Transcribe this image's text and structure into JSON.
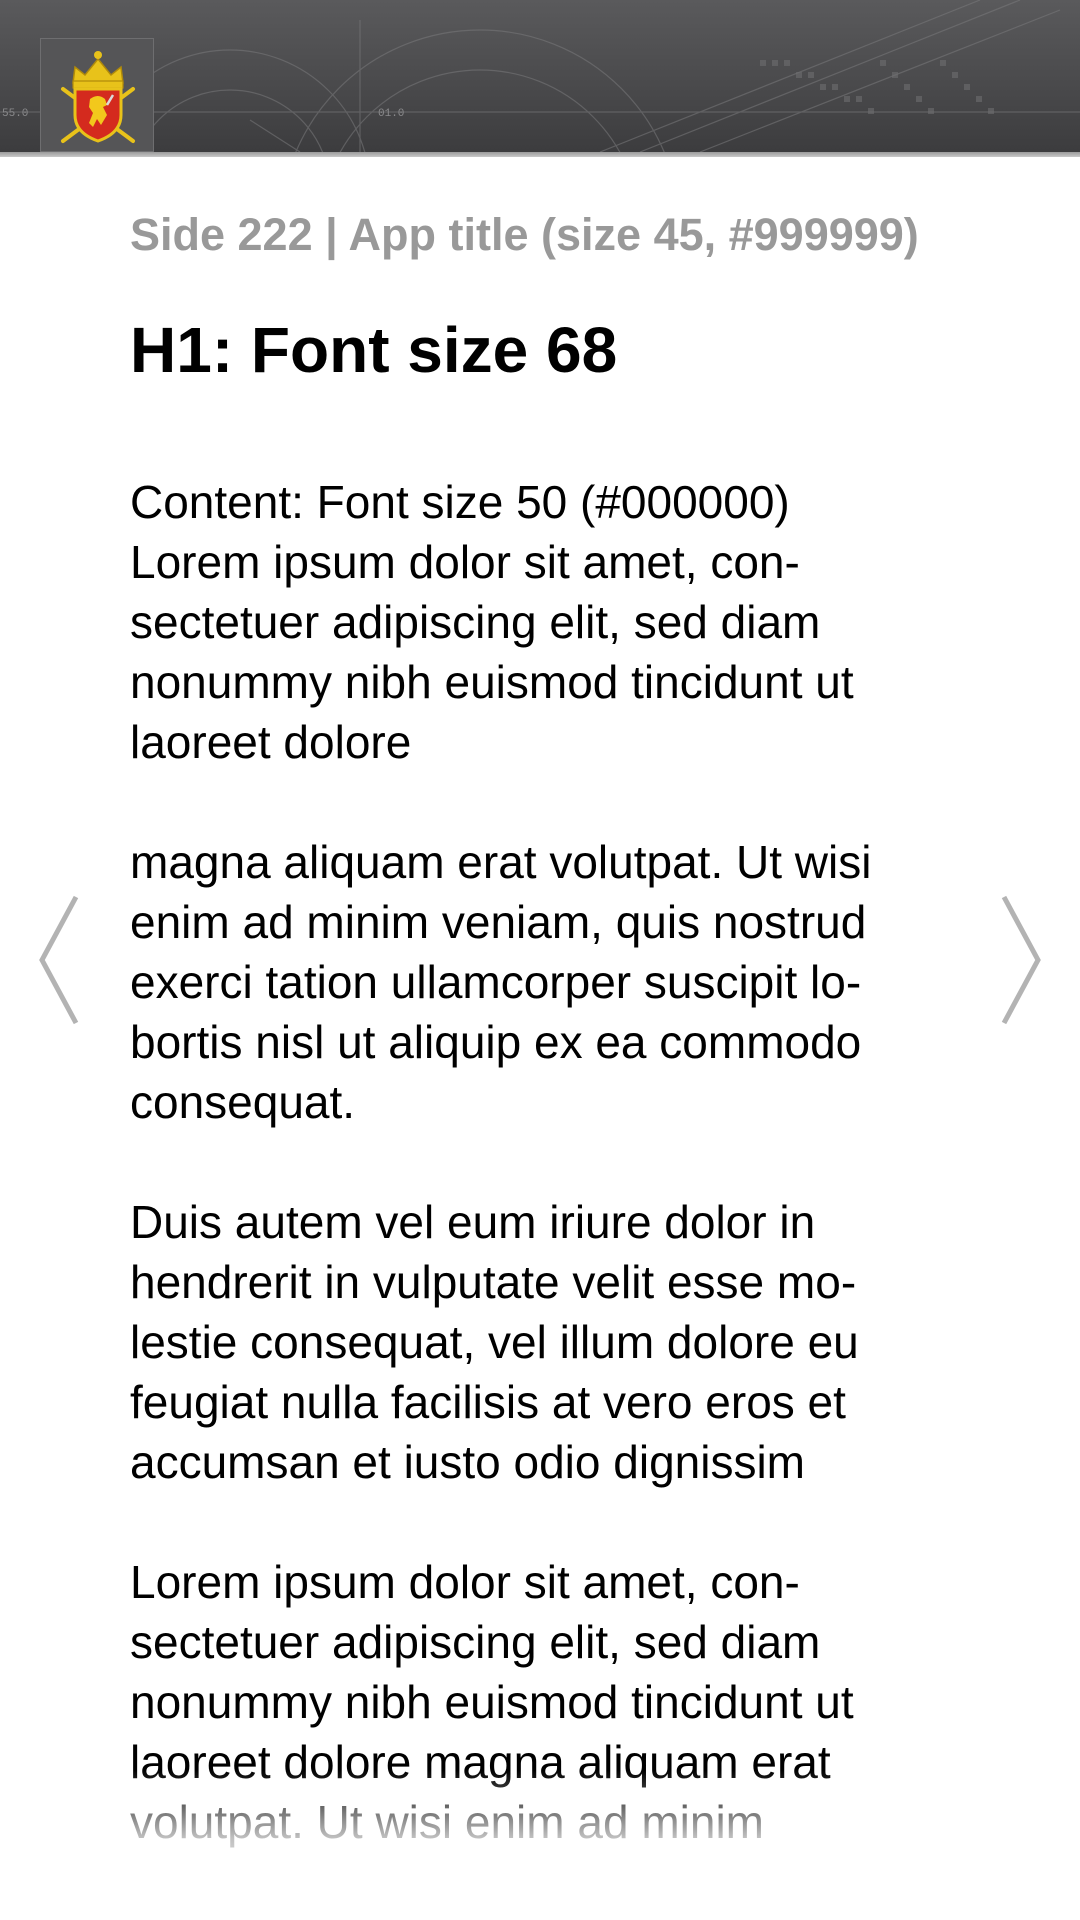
{
  "header": {
    "emblem": "norwegian-coat-of-arms",
    "deco_labels": [
      "55.0",
      "01.0"
    ]
  },
  "main": {
    "app_title": "Side 222 | App title (size 45, #999999)",
    "heading": "H1: Font size 68",
    "paragraphs": [
      "Content: Font size 50 (#000000)\nLorem ipsum dolor sit amet, con-\nsectetuer adipiscing elit, sed diam\nnonummy nibh euismod tincidunt ut\nlaoreet dolore",
      "magna aliquam erat volutpat. Ut wisi\nenim ad minim veniam, quis nostrud\nexerci tation ullamcorper suscipit lo-\nbortis nisl ut aliquip ex ea commodo\nconsequat.",
      "Duis autem vel eum iriure dolor in\nhendrerit in vulputate velit esse mo-\nlestie consequat, vel illum dolore eu\nfeugiat nulla facilisis at vero eros et\naccumsan et iusto odio dignissim",
      "Lorem ipsum dolor sit amet, con-\nsectetuer adipiscing elit, sed diam\nnonummy nibh euismod tincidunt ut\nlaoreet dolore magna aliquam erat\nvolutpat. Ut wisi enim ad minim"
    ]
  },
  "nav": {
    "prev_icon": "chevron-left-icon",
    "next_icon": "chevron-right-icon"
  },
  "colors": {
    "header_bg": "#4a4a4c",
    "app_title": "#999999",
    "content_text": "#000000",
    "arrow": "#b3b3b3"
  }
}
